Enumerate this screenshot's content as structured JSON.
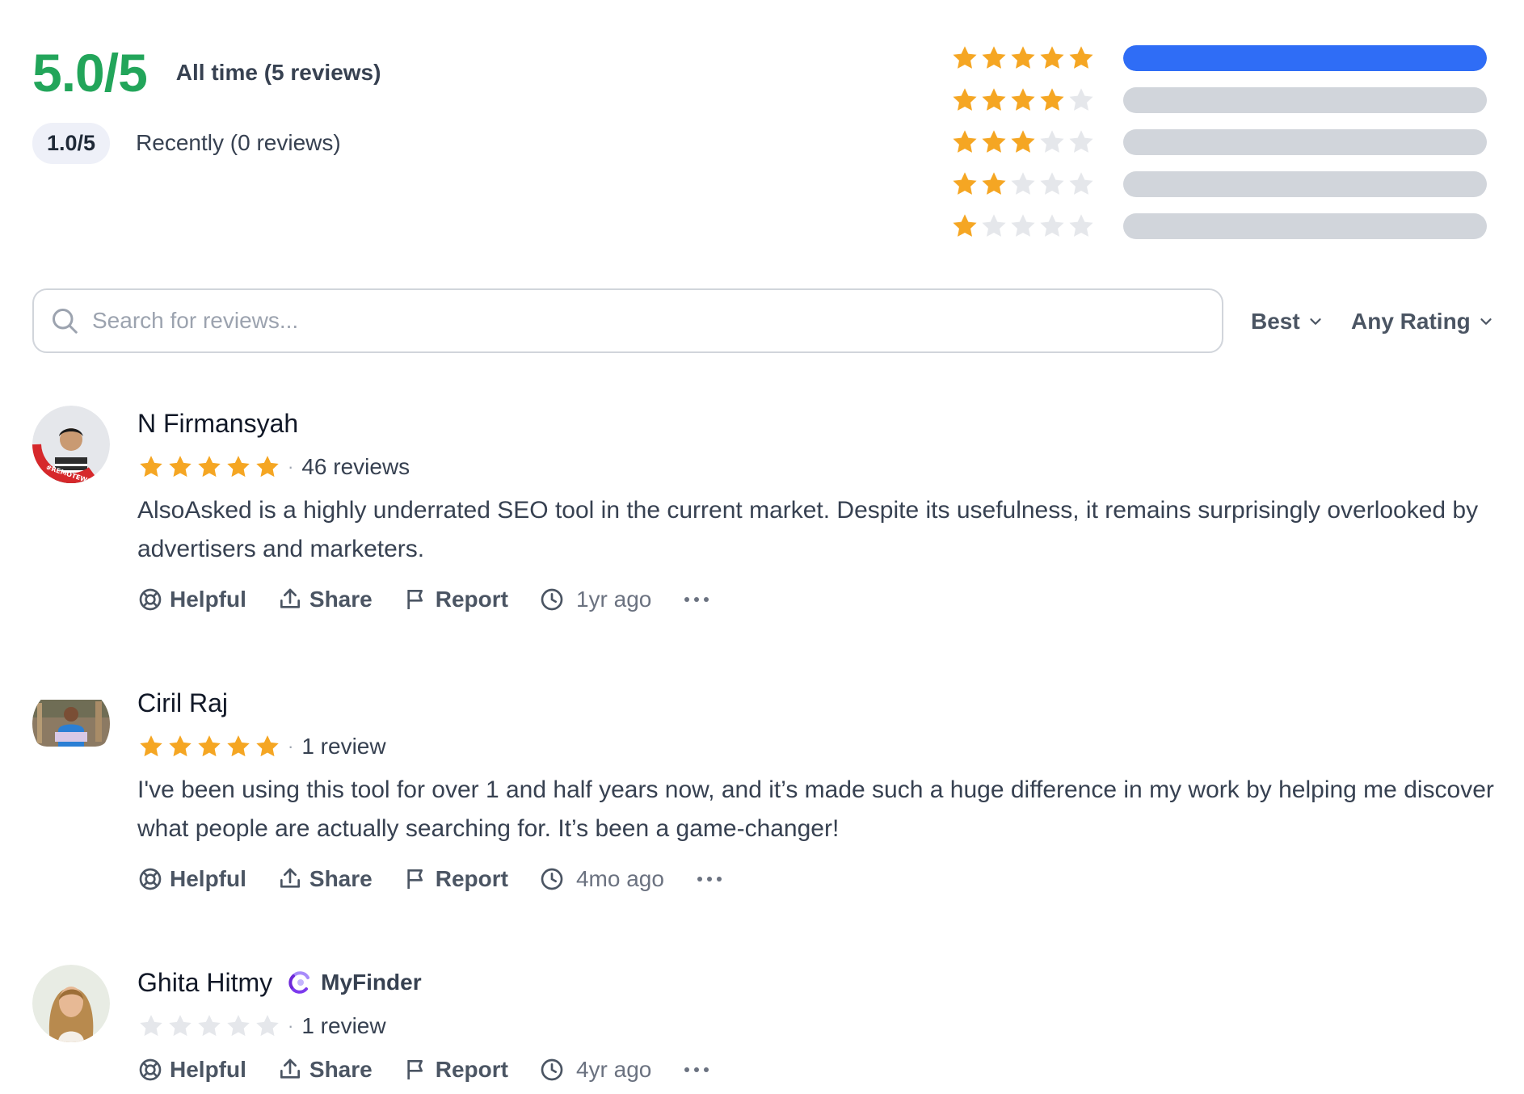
{
  "summary": {
    "overall_score": "5.0/5",
    "overall_label": "All time (5 reviews)",
    "recent_score": "1.0/5",
    "recent_label": "Recently (0 reviews)",
    "score_color": "#22a55a"
  },
  "distribution": [
    {
      "stars": 5,
      "fraction": 1.0
    },
    {
      "stars": 4,
      "fraction": 0
    },
    {
      "stars": 3,
      "fraction": 0
    },
    {
      "stars": 2,
      "fraction": 0
    },
    {
      "stars": 1,
      "fraction": 0
    }
  ],
  "search": {
    "placeholder": "Search for reviews..."
  },
  "filters": {
    "sort": "Best",
    "rating": "Any Rating"
  },
  "actions": {
    "helpful": "Helpful",
    "share": "Share",
    "report": "Report"
  },
  "reviews": [
    {
      "name": "N Firmansyah",
      "company": "",
      "stars": 5,
      "review_count": "46 reviews",
      "text": "AlsoAsked is a highly underrated SEO tool in the current market. Despite its usefulness, it remains surprisingly overlooked by advertisers and marketers.",
      "time": "1yr ago",
      "avatar_badge": "#REMOTEWORKER"
    },
    {
      "name": "Ciril Raj",
      "company": "",
      "stars": 5,
      "review_count": "1 review",
      "text": "I've been using this tool for over 1 and half years now, and it’s made such a huge difference in my work by helping me discover what people are actually searching for. It’s been a game-changer!",
      "time": "4mo ago"
    },
    {
      "name": "Ghita Hitmy",
      "company": "MyFinder",
      "stars": 0,
      "review_count": "1 review",
      "text": "",
      "time": "4yr ago"
    }
  ],
  "colors": {
    "star_filled": "#f5a623",
    "star_empty": "#e5e7eb",
    "bar_fill": "#2f6df6",
    "bar_empty": "#d1d5db"
  }
}
